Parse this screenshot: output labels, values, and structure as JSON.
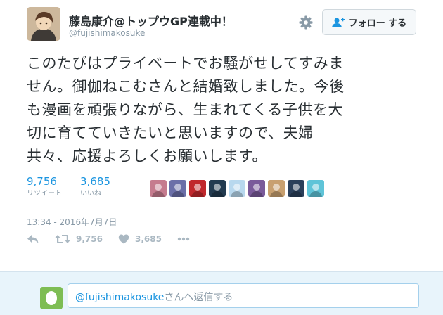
{
  "user": {
    "display_name": "藤島康介@トップウGP連載中！",
    "handle": "@fujishimakosuke"
  },
  "follow_button": {
    "label": "フォロー する"
  },
  "tweet": {
    "lines": [
      "このたびはプライベートでお騒がせしてすみま",
      "せん。御伽ねこむさんと結婚致しました。今後",
      "も漫画を頑張りながら、生まれてくる子供を大",
      "切に育てていきたいと思いますので、夫婦",
      "共々、応援よろしくお願いします。"
    ],
    "timestamp": "13:34 - 2016年7月7日"
  },
  "stats": {
    "retweets": {
      "count": "9,756",
      "label": "リツイート"
    },
    "likes": {
      "count": "3,685",
      "label": "いいね"
    }
  },
  "actions": {
    "retweet_count": "9,756",
    "like_count": "3,685",
    "icons": [
      "reply-icon",
      "retweet-icon",
      "like-heart-icon",
      "more-dots-icon"
    ]
  },
  "reply": {
    "mention": "@fujishimakosuke",
    "placeholder_suffix": "さんへ返信する"
  },
  "liker_colors": [
    "#c57b8e",
    "#6b6fa8",
    "#c0282d",
    "#223a4f",
    "#b8d8ee",
    "#7a5a9a",
    "#c8a070",
    "#2a3f5a",
    "#5fc4d8"
  ],
  "colors": {
    "link": "#1b95e0",
    "muted": "#8899a6",
    "text": "#292f33",
    "reply_bg": "#e8f4fb",
    "follow_bg": "#f5f8fa"
  }
}
